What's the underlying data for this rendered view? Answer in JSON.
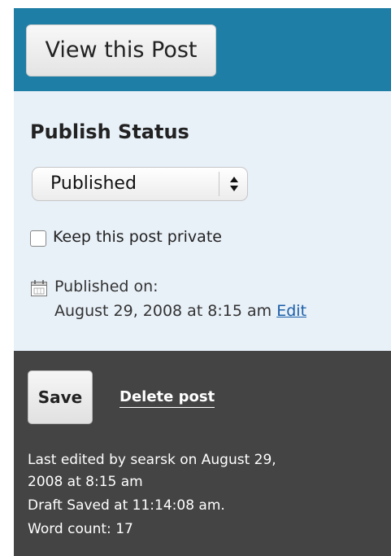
{
  "header": {
    "view_post_label": "View this Post"
  },
  "publish": {
    "title": "Publish Status",
    "status_selected": "Published",
    "private_label": "Keep this post private",
    "private_checked": false,
    "published_on_label": "Published on:",
    "published_date": "August 29, 2008 at 8:15 am",
    "edit_label": "Edit"
  },
  "actions": {
    "save_label": "Save",
    "delete_label": "Delete post",
    "last_edited_line1": "Last edited by searsk on August 29,",
    "last_edited_line2": "2008 at 8:15 am",
    "draft_saved": "Draft Saved at 11:14:08 am.",
    "word_count": "Word count: 17"
  },
  "icons": {
    "calendar": "calendar-icon",
    "select_arrows": "select-arrows-icon"
  },
  "colors": {
    "header_bg": "#1f7ea5",
    "status_bg": "#e8f0f8",
    "actions_bg": "#444444",
    "link": "#1b5fa8"
  }
}
